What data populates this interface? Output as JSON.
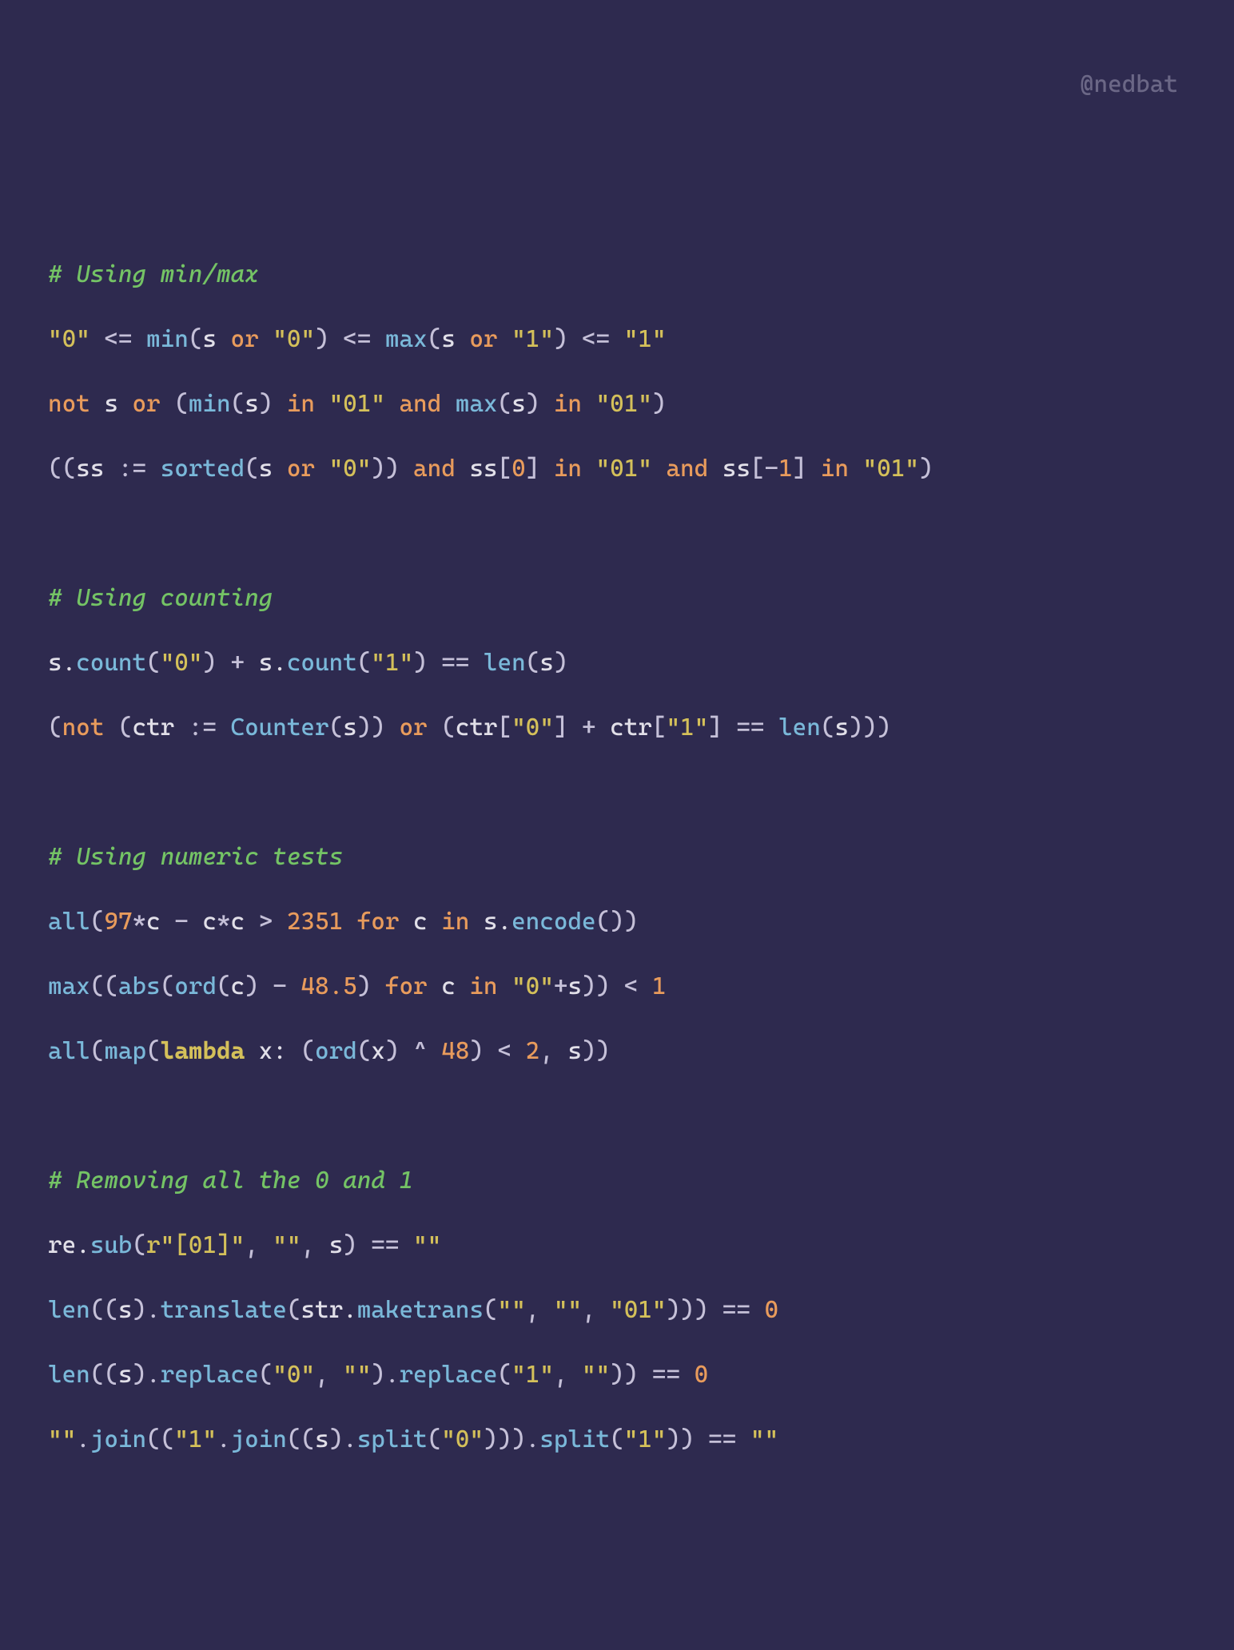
{
  "watermark": "@nedbat",
  "lines": {
    "c1": "# Using min/max",
    "l1": {
      "s1": "\"0\"",
      "o1": " <= ",
      "f1": "min",
      "p1": "(",
      "v1": "s",
      "o2": " or ",
      "s2": "\"0\"",
      "p2": ")",
      "o3": " <= ",
      "f2": "max",
      "p3": "(",
      "v2": "s",
      "o4": " or ",
      "s3": "\"1\"",
      "p4": ")",
      "o5": " <= ",
      "s4": "\"1\""
    },
    "l2": {
      "k1": "not ",
      "v1": "s",
      "o1": " or ",
      "p1": "(",
      "f1": "min",
      "p2": "(",
      "v2": "s",
      "p3": ")",
      "k2": " in ",
      "s1": "\"01\"",
      "o2": " and ",
      "f2": "max",
      "p4": "(",
      "v3": "s",
      "p5": ")",
      "k3": " in ",
      "s2": "\"01\"",
      "p6": ")"
    },
    "l3": {
      "p1": "((",
      "v1": "ss",
      "o1": " := ",
      "f1": "sorted",
      "p2": "(",
      "v2": "s",
      "o2": " or ",
      "s1": "\"0\"",
      "p3": "))",
      "o3": " and ",
      "v3": "ss",
      "p4": "[",
      "n1": "0",
      "p5": "]",
      "k1": " in ",
      "s2": "\"01\"",
      "o4": " and ",
      "v4": "ss",
      "p6": "[-",
      "n2": "1",
      "p7": "]",
      "k2": " in ",
      "s3": "\"01\"",
      "p8": ")"
    },
    "c2": "# Using counting",
    "l4": {
      "v1": "s.",
      "f1": "count",
      "p1": "(",
      "s1": "\"0\"",
      "p2": ")",
      "o1": " + ",
      "v2": "s.",
      "f2": "count",
      "p3": "(",
      "s2": "\"1\"",
      "p4": ")",
      "o2": " == ",
      "f3": "len",
      "p5": "(",
      "v3": "s",
      "p6": ")"
    },
    "l5": {
      "p1": "(",
      "k1": "not ",
      "p2": "(",
      "v1": "ctr",
      "o1": " := ",
      "f1": "Counter",
      "p3": "(",
      "v2": "s",
      "p4": "))",
      "o2": " or ",
      "p5": "(",
      "v3": "ctr",
      "p6": "[",
      "s1": "\"0\"",
      "p7": "]",
      "o3": " + ",
      "v4": "ctr",
      "p8": "[",
      "s2": "\"1\"",
      "p9": "]",
      "o4": " == ",
      "f2": "len",
      "p10": "(",
      "v5": "s",
      "p11": ")))"
    },
    "c3": "# Using numeric tests",
    "l6": {
      "f1": "all",
      "p1": "(",
      "n1": "97",
      "o1": "*",
      "v1": "c",
      "o2": " - ",
      "v2": "c",
      "o3": "*",
      "v3": "c",
      "o4": " > ",
      "n2": "2351",
      "k1": " for ",
      "v4": "c",
      "k2": " in ",
      "v5": "s.",
      "f2": "encode",
      "p2": "())"
    },
    "l7": {
      "f1": "max",
      "p1": "((",
      "f2": "abs",
      "p2": "(",
      "f3": "ord",
      "p3": "(",
      "v1": "c",
      "p4": ")",
      "o1": " - ",
      "n1": "48.5",
      "p5": ")",
      "k1": " for ",
      "v2": "c",
      "k2": " in ",
      "s1": "\"0\"",
      "o2": "+",
      "v3": "s",
      "p6": "))",
      "o3": " < ",
      "n2": "1"
    },
    "l8": {
      "f1": "all",
      "p1": "(",
      "f2": "map",
      "p2": "(",
      "lam": "lambda",
      "v1": " x: ",
      "p3": "(",
      "f3": "ord",
      "p4": "(",
      "v2": "x",
      "p5": ")",
      "o1": " ^ ",
      "n1": "48",
      "p6": ")",
      "o2": " < ",
      "n2": "2",
      "p7": ", ",
      "v3": "s",
      "p8": "))"
    },
    "c4": "# Removing all the 0 and 1",
    "l9": {
      "v1": "re.",
      "f1": "sub",
      "p1": "(",
      "s1": "r\"[01]\"",
      "p2": ", ",
      "s2": "\"\"",
      "p3": ", ",
      "v2": "s",
      "p4": ")",
      "o1": " == ",
      "s3": "\"\""
    },
    "l10": {
      "f1": "len",
      "p1": "((",
      "v1": "s",
      "p2": ").",
      "f2": "translate",
      "p3": "(",
      "v2": "str.",
      "f3": "maketrans",
      "p4": "(",
      "s1": "\"\"",
      "p5": ", ",
      "s2": "\"\"",
      "p6": ", ",
      "s3": "\"01\"",
      "p7": ")))",
      "o1": " == ",
      "n1": "0"
    },
    "l11": {
      "f1": "len",
      "p1": "((",
      "v1": "s",
      "p2": ").",
      "f2": "replace",
      "p3": "(",
      "s1": "\"0\"",
      "p4": ", ",
      "s2": "\"\"",
      "p5": ").",
      "f3": "replace",
      "p6": "(",
      "s3": "\"1\"",
      "p7": ", ",
      "s4": "\"\"",
      "p8": "))",
      "o1": " == ",
      "n1": "0"
    },
    "l12": {
      "s1": "\"\"",
      "p1": ".",
      "f1": "join",
      "p2": "((",
      "s2": "\"1\"",
      "p3": ".",
      "f2": "join",
      "p4": "((",
      "v1": "s",
      "p5": ").",
      "f3": "split",
      "p6": "(",
      "s3": "\"0\"",
      "p7": "))).",
      "f4": "split",
      "p8": "(",
      "s4": "\"1\"",
      "p9": "))",
      "o1": " == ",
      "s5": "\"\""
    }
  }
}
